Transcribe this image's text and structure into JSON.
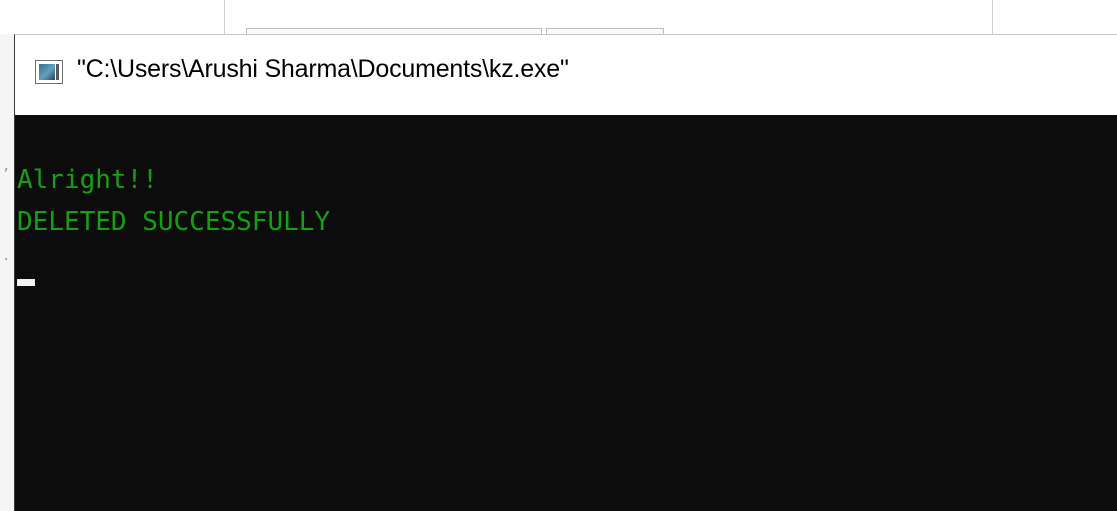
{
  "window": {
    "title": "\"C:\\Users\\Arushi Sharma\\Documents\\kz.exe\"",
    "icon": "console-app-icon"
  },
  "console": {
    "lines": [
      "Alright!!",
      "DELETED SUCCESSFULLY"
    ],
    "text_color": "#13a10e",
    "background_color": "#0c0c0c",
    "cursor_color": "#f2f2f2"
  }
}
